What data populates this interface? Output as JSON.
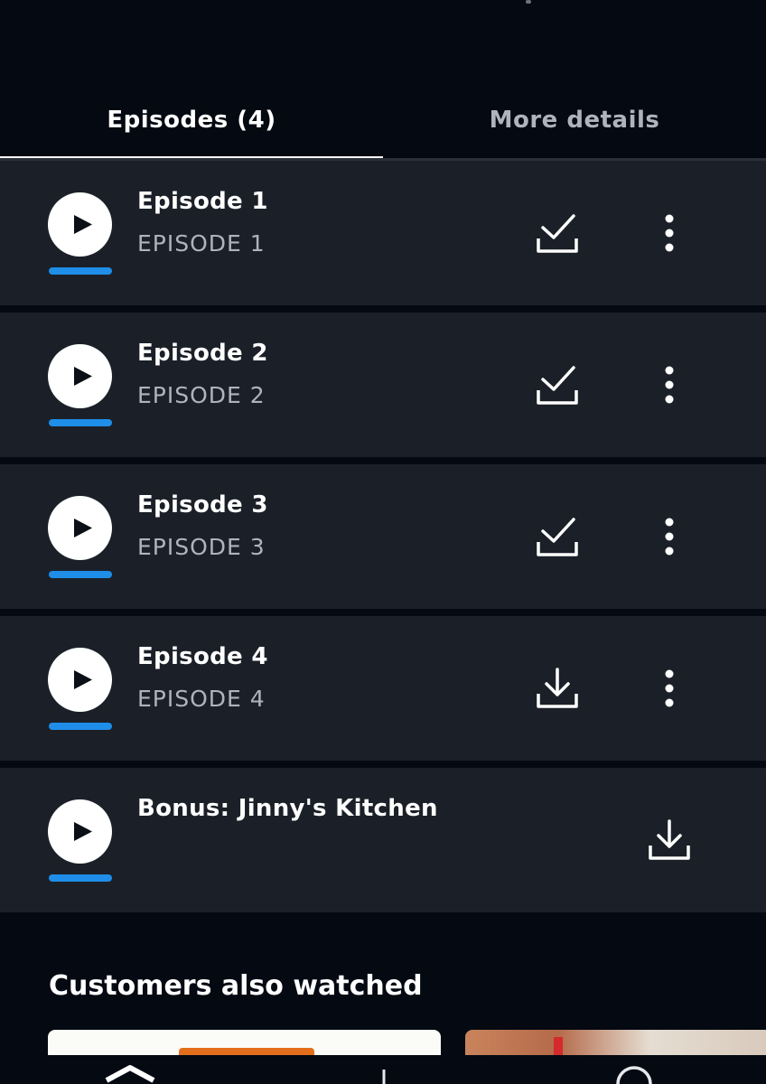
{
  "tabs": [
    {
      "label": "Episodes (4)",
      "active": true
    },
    {
      "label": "More details",
      "active": false
    }
  ],
  "episodes": [
    {
      "title": "Episode 1",
      "subtitle": "EPISODE 1",
      "download_state": "downloaded-check-icon",
      "watched_progress": 1.0,
      "has_menu": true
    },
    {
      "title": "Episode 2",
      "subtitle": "EPISODE 2",
      "download_state": "downloaded-check-icon",
      "watched_progress": 1.0,
      "has_menu": true
    },
    {
      "title": "Episode 3",
      "subtitle": "EPISODE 3",
      "download_state": "downloaded-check-icon",
      "watched_progress": 1.0,
      "has_menu": true
    },
    {
      "title": "Episode 4",
      "subtitle": "EPISODE 4",
      "download_state": "download-icon",
      "watched_progress": 1.0,
      "has_menu": true
    },
    {
      "title": "Bonus: Jinny's Kitchen",
      "subtitle": "",
      "download_state": "download-icon",
      "watched_progress": 1.0,
      "has_menu": false
    }
  ],
  "related": {
    "title": "Customers also watched"
  },
  "colors": {
    "background": "#040912",
    "row_background": "#1b2028",
    "progress_accent": "#1f8ee8",
    "inactive_text": "#aeb4bb"
  },
  "navbar": {
    "icons": [
      "home-icon",
      "downloads-icon",
      "search-icon"
    ]
  }
}
